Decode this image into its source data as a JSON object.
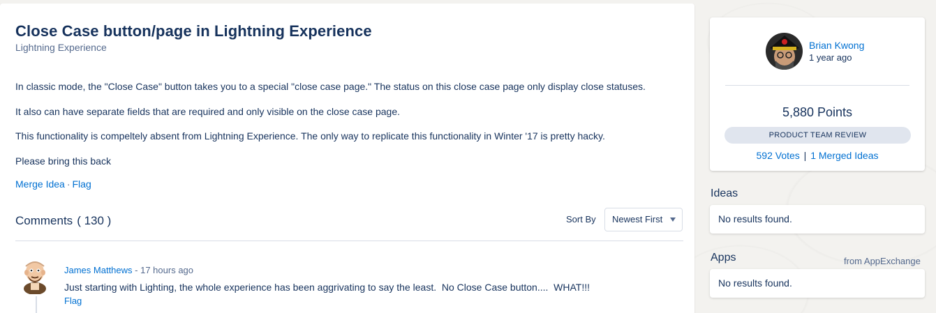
{
  "idea": {
    "title": "Close Case button/page in Lightning Experience",
    "category": "Lightning Experience",
    "paragraphs": [
      "In classic mode, the \"Close Case\" button takes you to a special \"close case page.\" The status on this close case page only display close statuses.",
      "It also can have separate fields that are required and only visible on the close case page.",
      "This functionality is compeltely absent from Lightning Experience. The only way to replicate this functionality in Winter '17 is pretty hacky.",
      "Please bring this back"
    ],
    "actions": {
      "merge_label": "Merge Idea",
      "separator": "·",
      "flag_label": "Flag"
    }
  },
  "comments": {
    "heading": "Comments",
    "count": "( 130 )",
    "sort_label": "Sort By",
    "sort_value": "Newest First",
    "items": [
      {
        "author": "James Matthews",
        "time": "- 17 hours ago",
        "text": "Just starting with Lighting, the whole experience has been aggrivating to say the least.  No Close Case button....  WHAT!!!",
        "flag_label": "Flag"
      }
    ]
  },
  "author_card": {
    "name": "Brian Kwong",
    "time": "1 year ago",
    "points": "5,880 Points",
    "status": "PRODUCT TEAM REVIEW",
    "votes": "592 Votes",
    "votes_separator": "|",
    "merged": "1 Merged Ideas"
  },
  "sidebar": {
    "ideas_heading": "Ideas",
    "ideas_empty": "No results found.",
    "apps_heading": "Apps",
    "apps_source": "from AppExchange",
    "apps_empty": "No results found."
  },
  "colors": {
    "link": "#0070d2",
    "text": "#16325c",
    "muted": "#54698d",
    "pill": "#e0e5ee",
    "background": "#f3f2ef"
  }
}
